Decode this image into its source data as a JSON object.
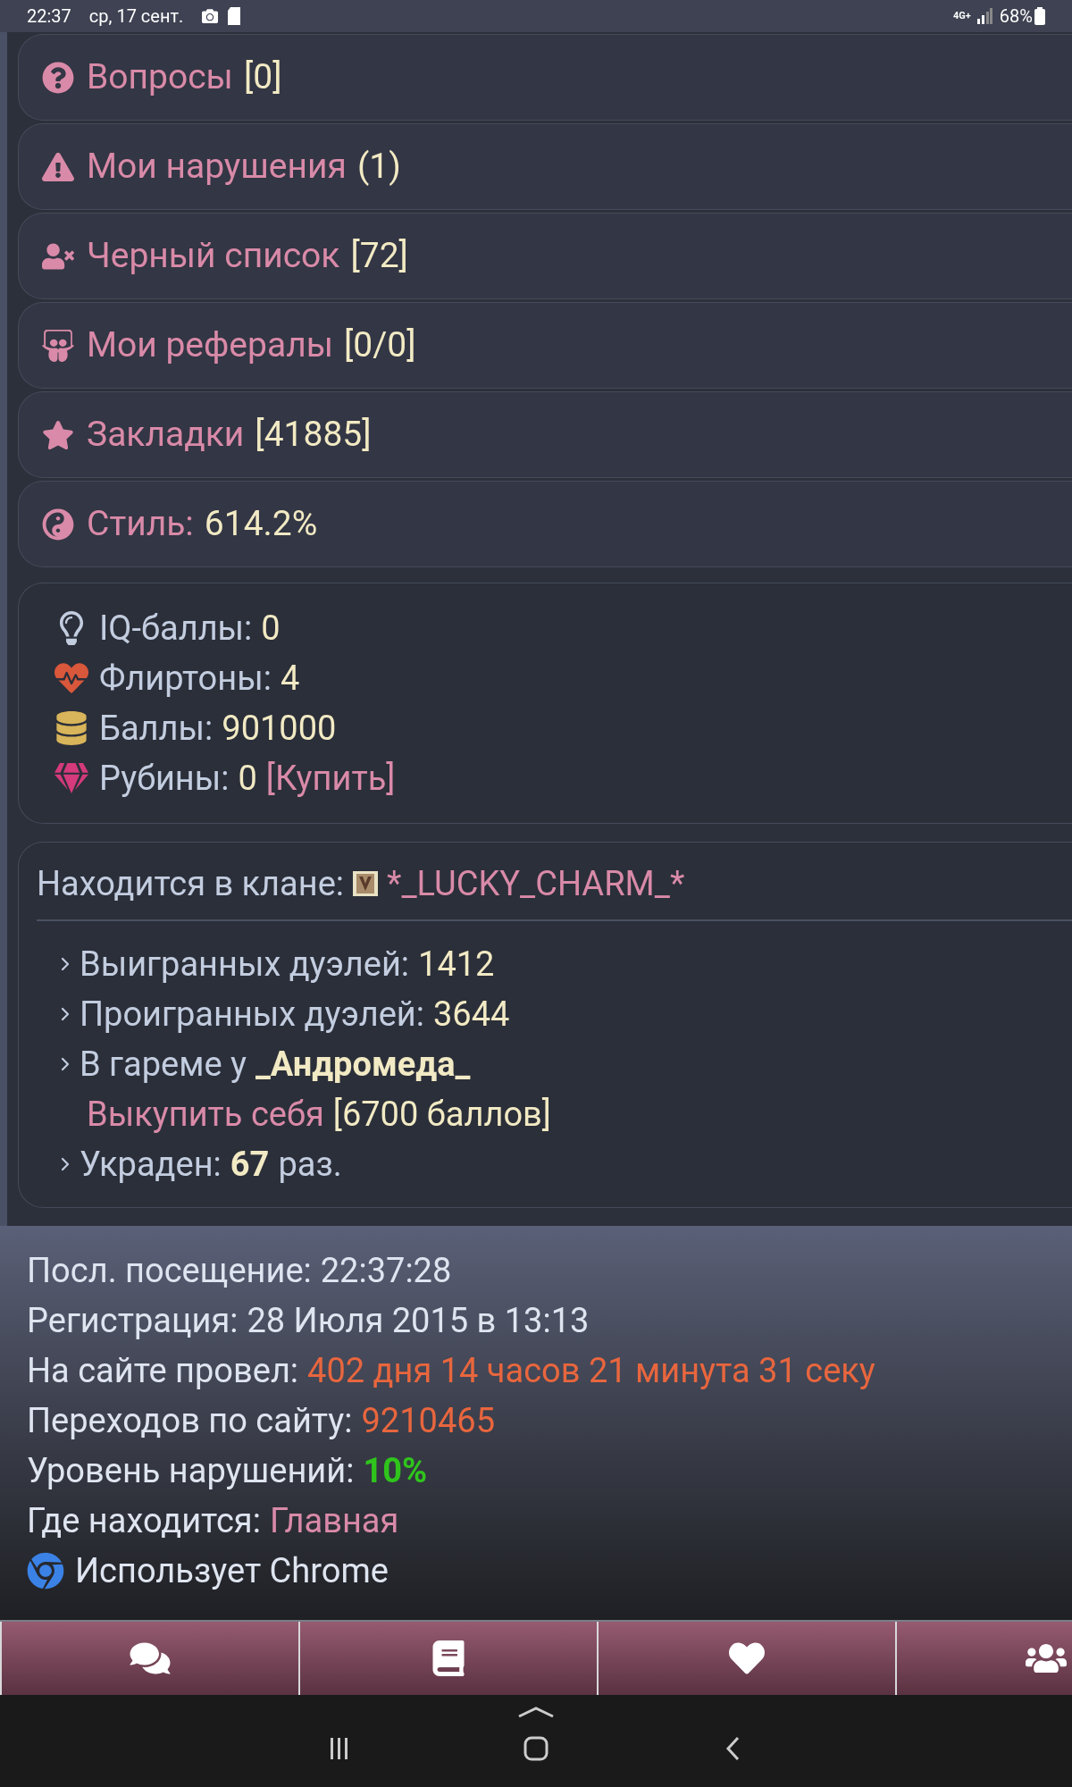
{
  "status_bar": {
    "time": "22:37",
    "date": "ср, 17 сент.",
    "network": "4G+",
    "battery": "68%"
  },
  "menu": [
    {
      "label": "Вопросы",
      "count": "[0]"
    },
    {
      "label": "Мои нарушения",
      "count": "(1)"
    },
    {
      "label": "Черный список",
      "count": "[72]"
    },
    {
      "label": "Мои рефералы",
      "count": "[0/0]"
    },
    {
      "label": "Закладки",
      "count": "[41885]"
    },
    {
      "label": "Стиль:",
      "count": "614.2%"
    }
  ],
  "stats": [
    {
      "label": "IQ-баллы:",
      "value": "0"
    },
    {
      "label": "Флиртоны:",
      "value": "4"
    },
    {
      "label": "Баллы:",
      "value": "901000"
    },
    {
      "label": "Рубины:",
      "value": "0",
      "link": "[Купить]"
    }
  ],
  "clan": {
    "label": "Находится в клане:",
    "name": "*_LUCKY_CHARM_*"
  },
  "duels": [
    {
      "kind": "stat",
      "label": "Выигранных дуэлей:",
      "value": "1412"
    },
    {
      "kind": "stat",
      "label": "Проигранных дуэлей:",
      "value": "3644"
    },
    {
      "kind": "harem",
      "label": "В гареме у",
      "owner": "_Андромеда_",
      "action": "Выкупить себя",
      "price": "[6700 баллов]"
    },
    {
      "kind": "stolen",
      "label": "Украден:",
      "value": "67",
      "suffix": "раз."
    }
  ],
  "info": [
    {
      "kind": "plain",
      "label": "Посл. посещение:",
      "value": "22:37:28"
    },
    {
      "kind": "plain",
      "label": "Регистрация:",
      "value": "28 Июля 2015 в 13:13"
    },
    {
      "kind": "orange",
      "label": "На сайте провел:",
      "value": "402 дня 14 часов 21 минута 31 секу"
    },
    {
      "kind": "orange",
      "label": "Переходов по сайту:",
      "value": "9210465"
    },
    {
      "kind": "green",
      "label": "Уровень нарушений:",
      "value": "10%"
    },
    {
      "kind": "pink",
      "label": "Где находится:",
      "value": "Главная"
    }
  ],
  "browser": "Использует Chrome"
}
